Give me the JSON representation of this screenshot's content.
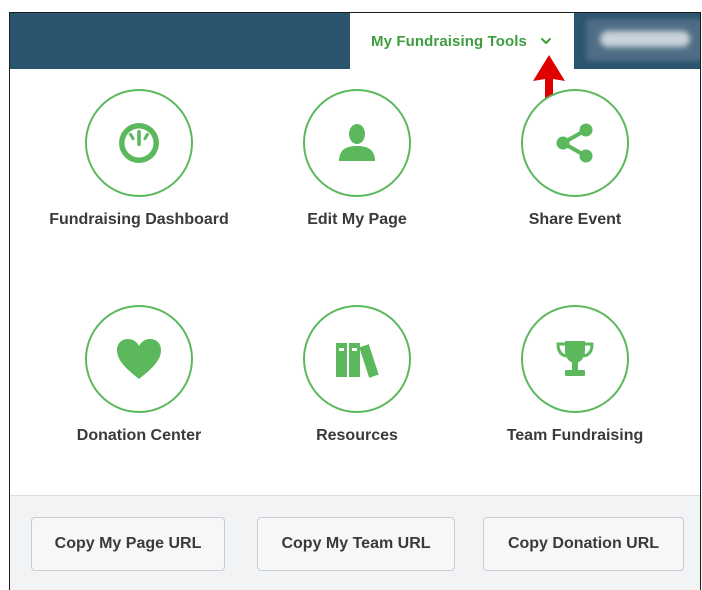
{
  "header": {
    "active_tab_label": "My Fundraising Tools",
    "user_name_blurred": ""
  },
  "tools": [
    {
      "label": "Fundraising Dashboard",
      "icon": "speedometer-icon"
    },
    {
      "label": "Edit My Page",
      "icon": "user-icon"
    },
    {
      "label": "Share Event",
      "icon": "share-icon"
    },
    {
      "label": "Donation Center",
      "icon": "heart-icon"
    },
    {
      "label": "Resources",
      "icon": "books-icon"
    },
    {
      "label": "Team Fundraising",
      "icon": "trophy-icon"
    }
  ],
  "footer_buttons": [
    {
      "label": "Copy My Page URL"
    },
    {
      "label": "Copy My Team URL"
    },
    {
      "label": "Copy Donation URL"
    }
  ],
  "colors": {
    "topbar": "#2b546f",
    "accent_green": "#5cb85c",
    "tab_text_green": "#3f9d3f",
    "annotation_arrow": "#e00000"
  }
}
